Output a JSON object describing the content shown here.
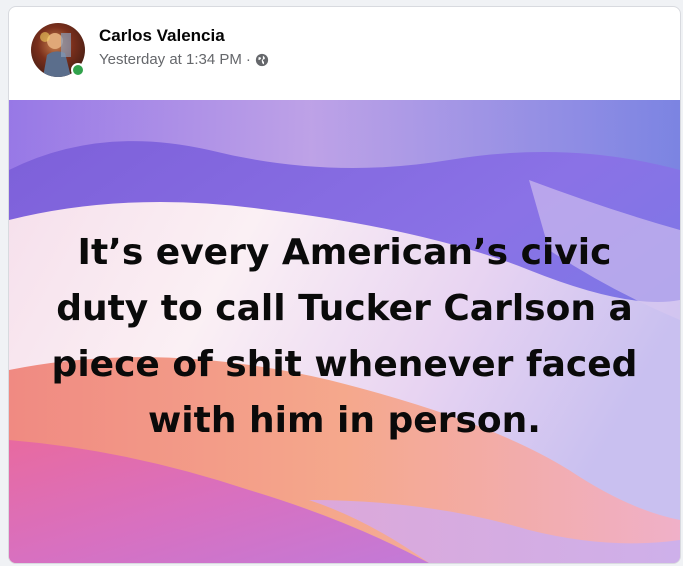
{
  "post": {
    "author": "Carlos Valencia",
    "timestamp": "Yesterday at 1:34 PM",
    "separator": "·",
    "privacy_icon": "globe-icon",
    "online_status_color": "#31a24c",
    "image_text_lines": [
      "It’s every American’s civic",
      "duty to call Tucker Carlson a",
      "piece of shit whenever faced",
      "with him in person."
    ]
  }
}
